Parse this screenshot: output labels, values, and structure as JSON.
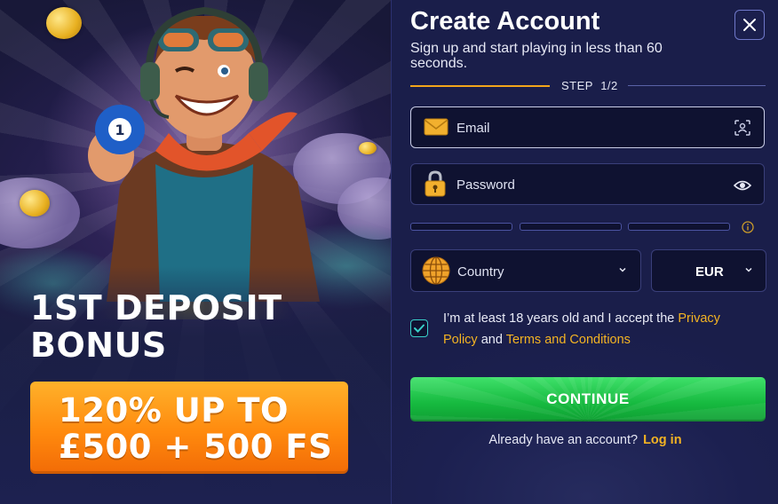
{
  "promo": {
    "title_line1": "1ST DEPOSIT",
    "title_line2": "BONUS",
    "offer_line1": "120% UP TO",
    "offer_line2": "£500 + 500 FS",
    "ball_number": "1"
  },
  "form": {
    "title": "Create Account",
    "subtitle": "Sign up and start playing in less than 60 seconds.",
    "step_label": "STEP",
    "step_value": "1/2",
    "email_placeholder": "Email",
    "password_placeholder": "Password",
    "country_placeholder": "Country",
    "currency_value": "EUR",
    "consent_text": "I’m at least 18 years old and I accept the ",
    "privacy_link": "Privacy Policy",
    "consent_and": " and ",
    "terms_link": "Terms and Conditions",
    "consent_checked": true,
    "continue_label": "CONTINUE",
    "login_prompt": "Already have an account?",
    "login_link": "Log in"
  },
  "icons": {
    "close": "close-icon",
    "email": "envelope-icon",
    "email_right": "face-scan-icon",
    "password": "padlock-icon",
    "password_right": "eye-icon",
    "country": "globe-icon",
    "chevron": "chevron-down-icon",
    "info": "info-icon",
    "check": "checkmark-icon"
  },
  "colors": {
    "accent": "#f3b323",
    "continue_green": "#16b93f",
    "offer_orange": "#ff8a0e",
    "checkbox_teal": "#39d0c9",
    "panel_bg": "#1c2050"
  }
}
